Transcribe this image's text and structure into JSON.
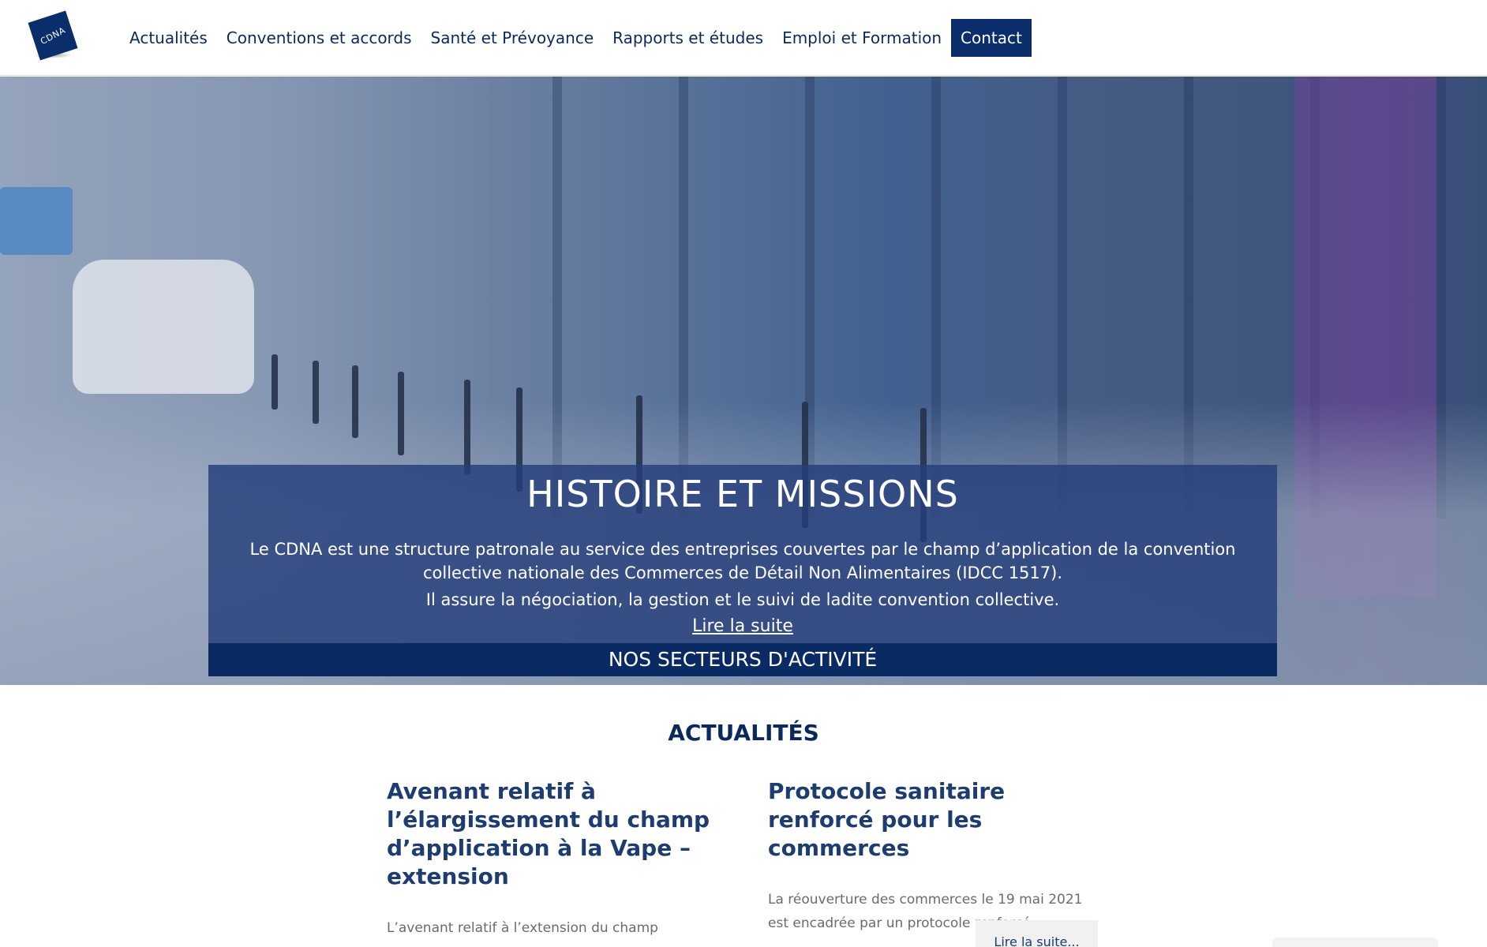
{
  "logo": {
    "text": "CDNA"
  },
  "nav": {
    "items": [
      {
        "label": "Actualités"
      },
      {
        "label": "Conventions et accords"
      },
      {
        "label": "Santé et Prévoyance"
      },
      {
        "label": "Rapports et études"
      },
      {
        "label": "Emploi et Formation"
      },
      {
        "label": "Contact"
      }
    ]
  },
  "hero": {
    "title": "HISTOIRE ET MISSIONS",
    "text": "Le CDNA est une structure patronale au service des entreprises couvertes par le champ d’application de la convention collective nationale des Commerces de Détail Non Alimentaires (IDCC 1517).",
    "text2": "Il assure la négociation, la gestion et le suivi de ladite convention collective.",
    "link": "Lire la suite",
    "sectors_button": "NOS SECTEURS D'ACTIVITÉ"
  },
  "news": {
    "heading": "ACTUALITÉS",
    "cards": [
      {
        "title": "Avenant relatif à l’élargissement du champ d’application à la Vape – extension",
        "excerpt": "L’avenant relatif à l’extension du champ"
      },
      {
        "title": "Protocole sanitaire renforcé pour les commerces",
        "excerpt": "La réouverture des commerces le 19 mai 2021 est encadrée par un protocole renforcé.",
        "read_more": "Lire la suite..."
      }
    ]
  },
  "colors": {
    "brand": "#0a2d6b",
    "hero_panel": "#243e7a",
    "sectors_bar": "#0a2a64"
  }
}
